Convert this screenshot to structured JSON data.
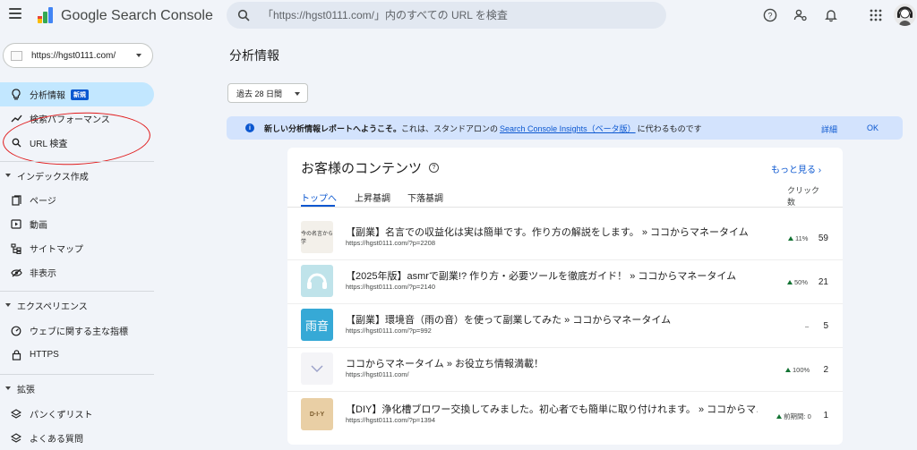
{
  "header": {
    "product": "Google Search Console",
    "search_placeholder": "「https://hgst0111.com/」内のすべての URL を検査"
  },
  "sidebar": {
    "property": "https://hgst0111.com/",
    "items": [
      {
        "label": "分析情報",
        "badge": "新規",
        "icon": "lightbulb-icon"
      },
      {
        "label": "検索パフォーマンス",
        "icon": "trend-icon"
      },
      {
        "label": "URL 検査",
        "icon": "search-icon"
      }
    ],
    "index_section": {
      "label": "インデックス作成",
      "items": [
        {
          "label": "ページ",
          "icon": "pages-icon"
        },
        {
          "label": "動画",
          "icon": "video-icon"
        },
        {
          "label": "サイトマップ",
          "icon": "sitemap-icon"
        },
        {
          "label": "非表示",
          "icon": "hidden-eye-icon"
        }
      ]
    },
    "experience_section": {
      "label": "エクスペリエンス",
      "items": [
        {
          "label": "ウェブに関する主な指標",
          "icon": "gauge-icon"
        },
        {
          "label": "HTTPS",
          "icon": "lock-icon"
        }
      ]
    },
    "enhancements_section": {
      "label": "拡張",
      "items": [
        {
          "label": "パンくずリスト",
          "icon": "layers-icon"
        },
        {
          "label": "よくある質問",
          "icon": "layers-icon"
        }
      ]
    }
  },
  "main": {
    "title": "分析情報",
    "period": "過去 28 日間",
    "banner": {
      "bold": "新しい分析情報レポートへようこそ。",
      "text1": "これは、スタンドアロンの",
      "link": "Search Console Insights（ベータ版）",
      "text2": "に代わるものです",
      "details": "詳細",
      "ok": "OK"
    },
    "card": {
      "title": "お客様のコンテンツ",
      "more": "もっと見る",
      "tabs": [
        "トップへ",
        "上昇基調",
        "下落基調"
      ],
      "clicks_header_1": "クリック",
      "clicks_header_2": "数",
      "rows": [
        {
          "title": "【副業】名言での収益化は実は簡単です。作り方の解説をします。 » ココからマネータイム",
          "url": "https://hgst0111.com/?p=2208",
          "change": "11%",
          "trend": "up",
          "clicks": "59",
          "thumb_text": "今の名言から学",
          "thumb_bg": "#f3f0ea"
        },
        {
          "title": "【2025年版】asmrで副業!? 作り方・必要ツールを徹底ガイド！ » ココからマネータイム",
          "url": "https://hgst0111.com/?p=2140",
          "change": "50%",
          "trend": "up",
          "clicks": "21",
          "thumb_text": "",
          "thumb_bg": "#bfe3ea"
        },
        {
          "title": "【副業】環境音（雨の音）を使って副業してみた » ココからマネータイム",
          "url": "https://hgst0111.com/?p=992",
          "change": "–",
          "trend": "flat",
          "clicks": "5",
          "thumb_text": "雨音",
          "thumb_bg": "#36a9d6"
        },
        {
          "title": "ココからマネータイム » お役立ち情報満載！",
          "url": "https://hgst0111.com/",
          "change": "100%",
          "trend": "up",
          "clicks": "2",
          "thumb_text": "",
          "thumb_bg": "#f4f4f7"
        },
        {
          "title": "【DIY】浄化槽ブロワー交換してみました。初心者でも簡単に取り付けれます。 » ココからマ…",
          "url": "https://hgst0111.com/?p=1394",
          "change": "前期間: 0",
          "trend": "up",
          "clicks": "1",
          "thumb_text": "D·I·Y",
          "thumb_bg": "#e9cfa5"
        }
      ]
    }
  }
}
